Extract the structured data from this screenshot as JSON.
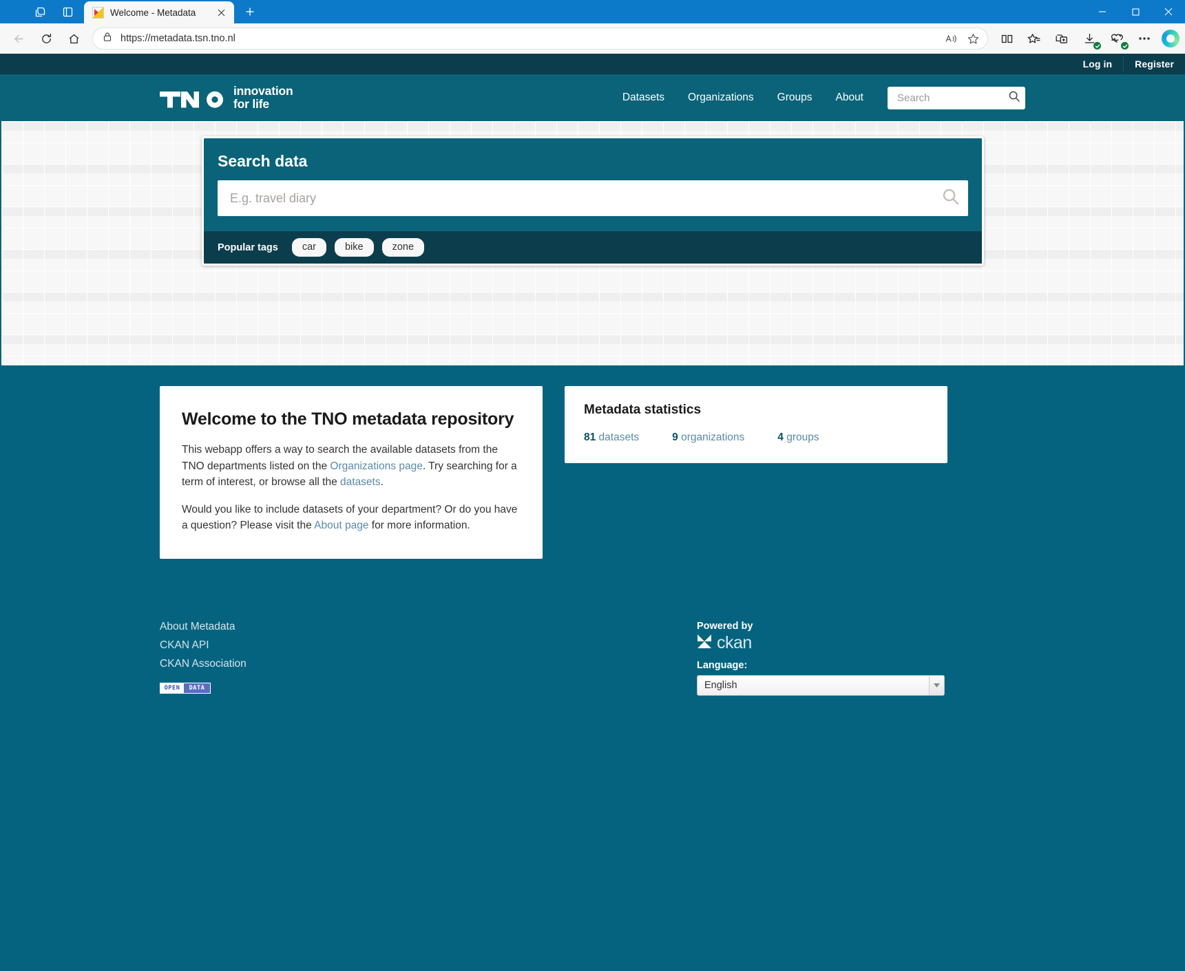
{
  "browser": {
    "tab": {
      "title": "Welcome - Metadata",
      "favicon": "metadata-favicon"
    },
    "url": "https://metadata.tsn.tno.nl",
    "new_tab_label": "+",
    "icons": {
      "back": "back-arrow-icon",
      "refresh": "refresh-icon",
      "home": "home-icon",
      "site_info": "lock-icon",
      "read_aloud": "read-aloud-icon",
      "favorite": "star-icon",
      "split_screen": "split-screen-icon",
      "favorites_bar": "favorites-icon",
      "collections": "collections-icon",
      "downloads": "downloads-icon",
      "browser_essentials": "browser-essentials-icon",
      "settings_more": "more-options-icon",
      "copilot": "copilot-icon",
      "minimize": "minimize-icon",
      "maximize": "maximize-icon",
      "close": "close-icon"
    }
  },
  "account_bar": {
    "login": "Log in",
    "register": "Register"
  },
  "header": {
    "logo_text": "TNO",
    "logo_tagline_line1": "innovation",
    "logo_tagline_line2": "for life",
    "nav": [
      {
        "label": "Datasets"
      },
      {
        "label": "Organizations"
      },
      {
        "label": "Groups"
      },
      {
        "label": "About"
      }
    ],
    "search": {
      "placeholder": "Search",
      "value": "",
      "icon": "search-icon"
    }
  },
  "hero": {
    "search_panel": {
      "title": "Search data",
      "input": {
        "placeholder": "E.g. travel diary",
        "value": "",
        "icon": "search-icon"
      },
      "tags_label": "Popular tags",
      "tags": [
        "car",
        "bike",
        "zone"
      ]
    }
  },
  "main": {
    "welcome": {
      "heading": "Welcome to the TNO metadata repository",
      "paragraph1_part1": "This webapp offers a way to search the available datasets from the TNO departments listed on the ",
      "paragraph1_link1": "Organizations page",
      "paragraph1_part2": ". Try searching for a term of interest, or browse all the ",
      "paragraph1_link2": "datasets",
      "paragraph1_part3": ".",
      "paragraph2_part1": "Would you like to include datasets of your department? Or do you have a question? Please visit the ",
      "paragraph2_link1": "About page",
      "paragraph2_part2": " for more information."
    },
    "statistics": {
      "heading": "Metadata statistics",
      "items": [
        {
          "count": "81",
          "label": " datasets"
        },
        {
          "count": "9",
          "label": " organizations"
        },
        {
          "count": "4",
          "label": " groups"
        }
      ]
    }
  },
  "footer": {
    "links": [
      {
        "label": "About Metadata"
      },
      {
        "label": "CKAN API"
      },
      {
        "label": "CKAN Association"
      }
    ],
    "open_data_badge": {
      "left": "OPEN",
      "right": "DATA"
    },
    "powered_by_label": "Powered by",
    "ckan_name": "ckan",
    "ckan_icon": "ckan-logo-icon",
    "language_label": "Language:",
    "language_value": "English",
    "language_arrow_icon": "chevron-down-icon"
  },
  "colors": {
    "brand_teal": "#0a6378",
    "dark_teal": "#0b3d4d",
    "page_teal": "#056380",
    "link_blue": "#5a8ba8",
    "titlebar_blue": "#0c7ac9"
  }
}
